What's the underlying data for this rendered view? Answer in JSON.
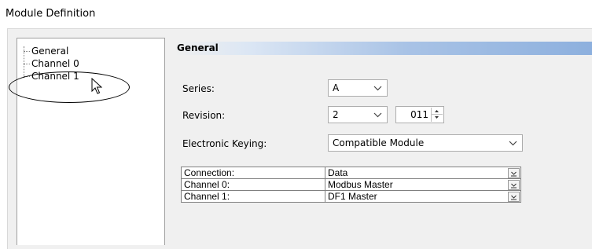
{
  "window": {
    "title": "Module Definition"
  },
  "tree": {
    "items": [
      {
        "label": "General"
      },
      {
        "label": "Channel 0"
      },
      {
        "label": "Channel 1"
      }
    ]
  },
  "panel": {
    "section_title": "General",
    "series": {
      "label": "Series:",
      "value": "A"
    },
    "revision": {
      "label": "Revision:",
      "major": "2",
      "minor": "011"
    },
    "keying": {
      "label": "Electronic Keying:",
      "value": "Compatible Module"
    }
  },
  "connections": [
    {
      "label": "Connection:",
      "value": "Data"
    },
    {
      "label": "Channel 0:",
      "value": "Modbus Master"
    },
    {
      "label": "Channel 1:",
      "value": "DF1 Master"
    }
  ]
}
